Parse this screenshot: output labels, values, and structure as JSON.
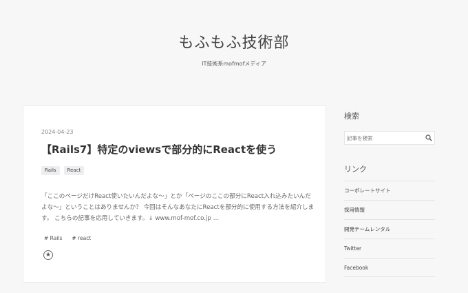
{
  "header": {
    "site_title": "もふもふ技術部",
    "tagline": "IT技術系mofmofメディア"
  },
  "article": {
    "date": "2024-04-23",
    "title": "【Rails7】特定のviewsで部分的にReactを使う",
    "categories": [
      "Rails",
      "React"
    ],
    "excerpt": "「ここのページだけReact使いたいんだよな〜」とか「ページのここの部分にReact入れ込みたいんだよな〜」ということはありませんか？ 今回はそんなあなたにReactを部分的に使用する方法を紹介します。 こちらの記事を応用していきます。↓ www.mof-mof.co.jp …",
    "tags": [
      "# Rails",
      "# react"
    ],
    "star_icon": "star-circle-icon"
  },
  "sidebar": {
    "search_heading": "検索",
    "search_placeholder": "記事を検索",
    "search_icon": "search-icon",
    "links_heading": "リンク",
    "links": [
      "コーポレートサイト",
      "採用情報",
      "開発チームレンタル",
      "Twitter",
      "Facebook"
    ]
  },
  "colors": {
    "background": "#f7f7f8",
    "card": "#ffffff",
    "text": "#333333"
  }
}
